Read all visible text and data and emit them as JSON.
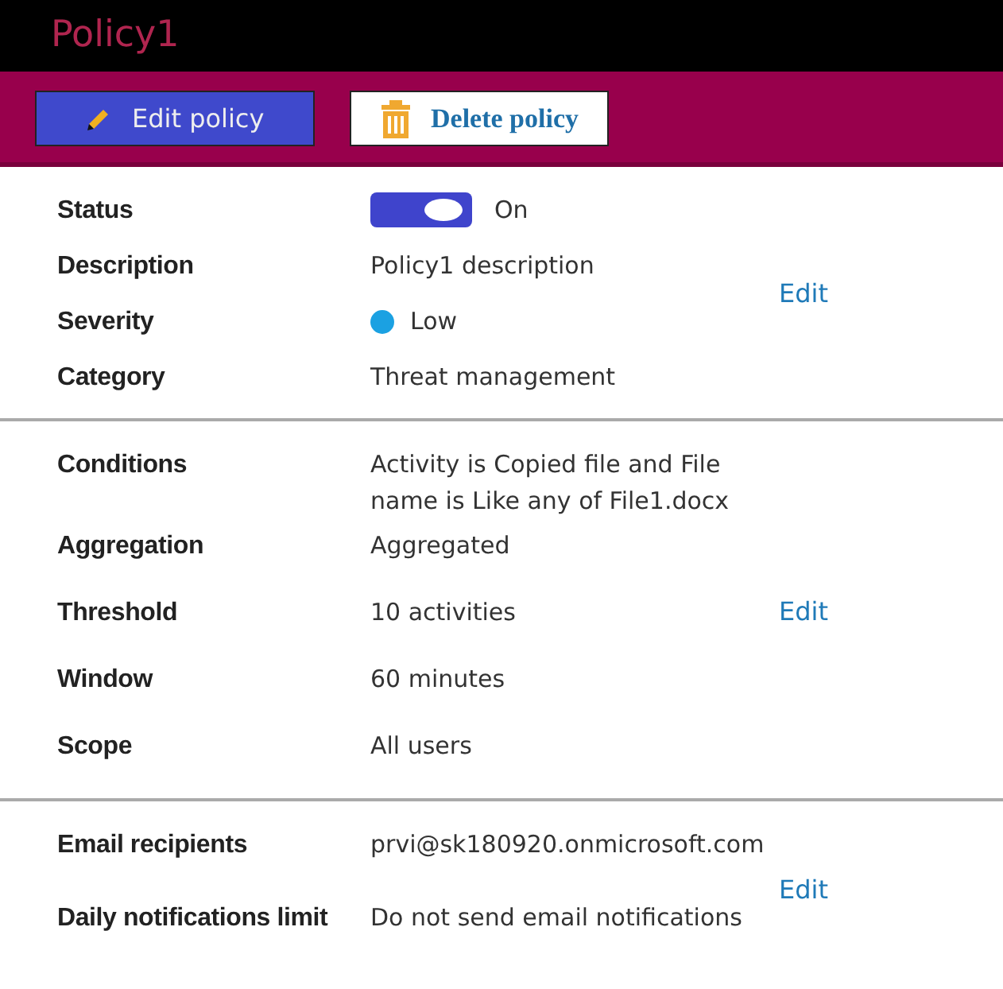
{
  "title": "Policy1",
  "actions": [
    {
      "label": "Edit policy",
      "kind": "edit"
    },
    {
      "label": "Delete policy",
      "kind": "delete"
    }
  ],
  "sections": [
    {
      "edit": "Edit",
      "rows": [
        {
          "label": "Status",
          "kind": "toggle",
          "value": "On",
          "on": true
        },
        {
          "label": "Description",
          "kind": "text",
          "value": "Policy1 description"
        },
        {
          "label": "Severity",
          "kind": "dot",
          "value": "Low",
          "color": "#1ba1e2"
        },
        {
          "label": "Category",
          "kind": "text",
          "value": "Threat management"
        }
      ]
    },
    {
      "edit": "Edit",
      "rows": [
        {
          "label": "Conditions",
          "kind": "text",
          "value": "Activity is Copied file and File name is Like any of File1.docx"
        },
        {
          "label": "Aggregation",
          "kind": "text",
          "value": "Aggregated"
        },
        {
          "label": "Threshold",
          "kind": "text",
          "value": "10 activities"
        },
        {
          "label": "Window",
          "kind": "text",
          "value": "60 minutes"
        },
        {
          "label": "Scope",
          "kind": "text",
          "value": "All users"
        }
      ]
    },
    {
      "edit": "Edit",
      "rows": [
        {
          "label": "Email recipients",
          "kind": "text",
          "value": "prvi@sk180920.onmicrosoft.com"
        },
        {
          "label": "Daily notifications limit",
          "kind": "text",
          "value": "Do not send email notifications"
        }
      ]
    }
  ]
}
